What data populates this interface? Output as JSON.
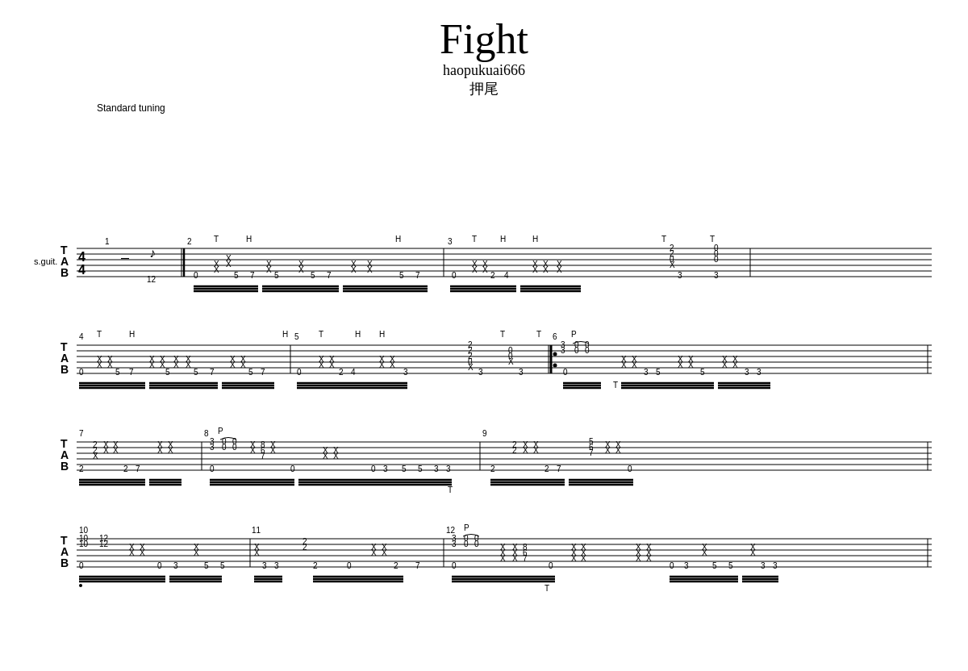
{
  "title": "Fight",
  "author": "haopukuai666",
  "subtitle": "押尾",
  "tuning": "Standard tuning"
}
